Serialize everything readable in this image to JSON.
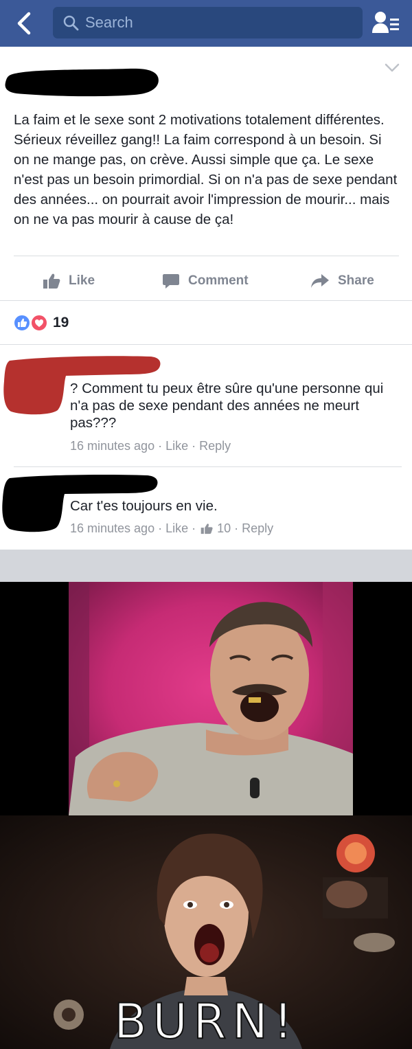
{
  "header": {
    "search_placeholder": "Search",
    "back_icon": "chevron-left-icon",
    "friends_icon": "friend-requests-icon",
    "bar_color": "#3b5998"
  },
  "post": {
    "author_redacted": true,
    "text": "La faim et le sexe sont 2 motivations totalement différentes. Sérieux réveillez gang!! La faim correspond à un besoin. Si on ne mange pas, on crève. Aussi simple que ça. Le sexe n'est pas un besoin primordial. Si on n'a pas de sexe pendant des années... on pourrait avoir l'impression de mourir... mais on ne va pas mourir à cause de ça!",
    "actions": {
      "like": "Like",
      "comment": "Comment",
      "share": "Share"
    },
    "reaction_count": "19"
  },
  "comments": [
    {
      "author_redacted": true,
      "text": "? Comment tu peux être sûre qu'une personne qui n'a pas de sexe pendant des années ne meurt pas???",
      "time": "16 minutes ago",
      "like": "Like",
      "reply": "Reply"
    },
    {
      "author_redacted": true,
      "text": "Car t'es toujours en vie.",
      "time": "16 minutes ago",
      "like": "Like",
      "likes_count": "10",
      "reply": "Reply"
    }
  ],
  "images": {
    "bottom_caption": "BURN!"
  }
}
